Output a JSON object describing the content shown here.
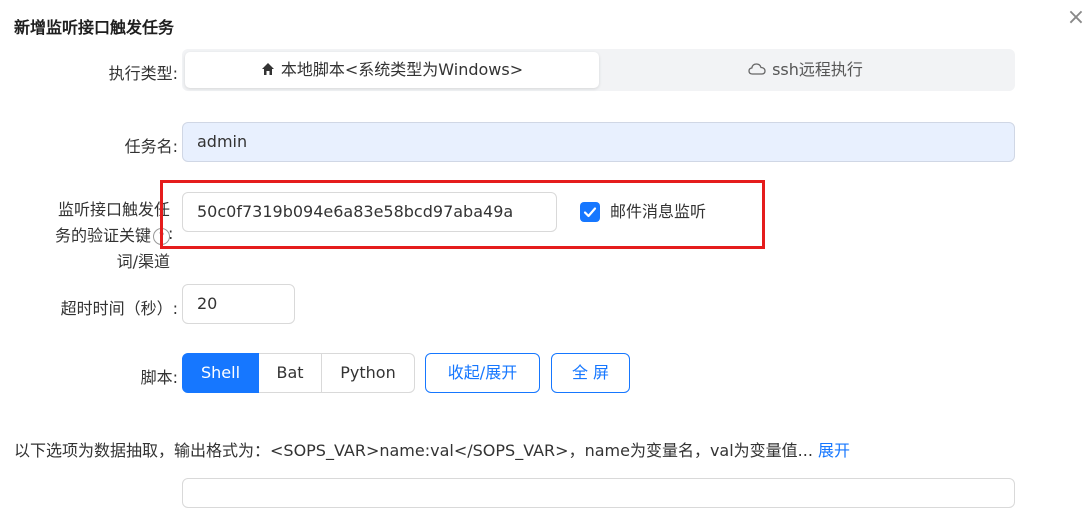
{
  "dialog": {
    "title": "新增监听接口触发任务",
    "close_glyph": "×"
  },
  "exec_type": {
    "label": "执行类型:",
    "options": [
      {
        "label": "本地脚本<系统类型为Windows>",
        "icon": "home-icon",
        "selected": true
      },
      {
        "label": "ssh远程执行",
        "icon": "cloud-icon",
        "selected": false
      }
    ]
  },
  "task_name": {
    "label": "任务名:",
    "value": "admin"
  },
  "keyword": {
    "label_line1": "监听接口触发任",
    "label_line2": "务的验证关键",
    "label_line3": "词/渠道",
    "colon": ":",
    "help_glyph": "?",
    "value": "50c0f7319b094e6a83e58bcd97aba49a",
    "mail_checkbox_label": "邮件消息监听",
    "mail_checked": true
  },
  "timeout": {
    "label": "超时时间（秒）:",
    "value": "20"
  },
  "script": {
    "label": "脚本:",
    "langs": [
      "Shell",
      "Bat",
      "Python"
    ],
    "selected": "Shell",
    "collapse_button": "收起/展开",
    "fullscreen_button": "全 屏"
  },
  "extract_note": {
    "text": "以下选项为数据抽取，输出格式为：<SOPS_VAR>name:val</SOPS_VAR>，name为变量名，val为变量值...",
    "link": "展开"
  },
  "colors": {
    "accent": "#1677ff",
    "highlight_box": "#e51c1c"
  }
}
